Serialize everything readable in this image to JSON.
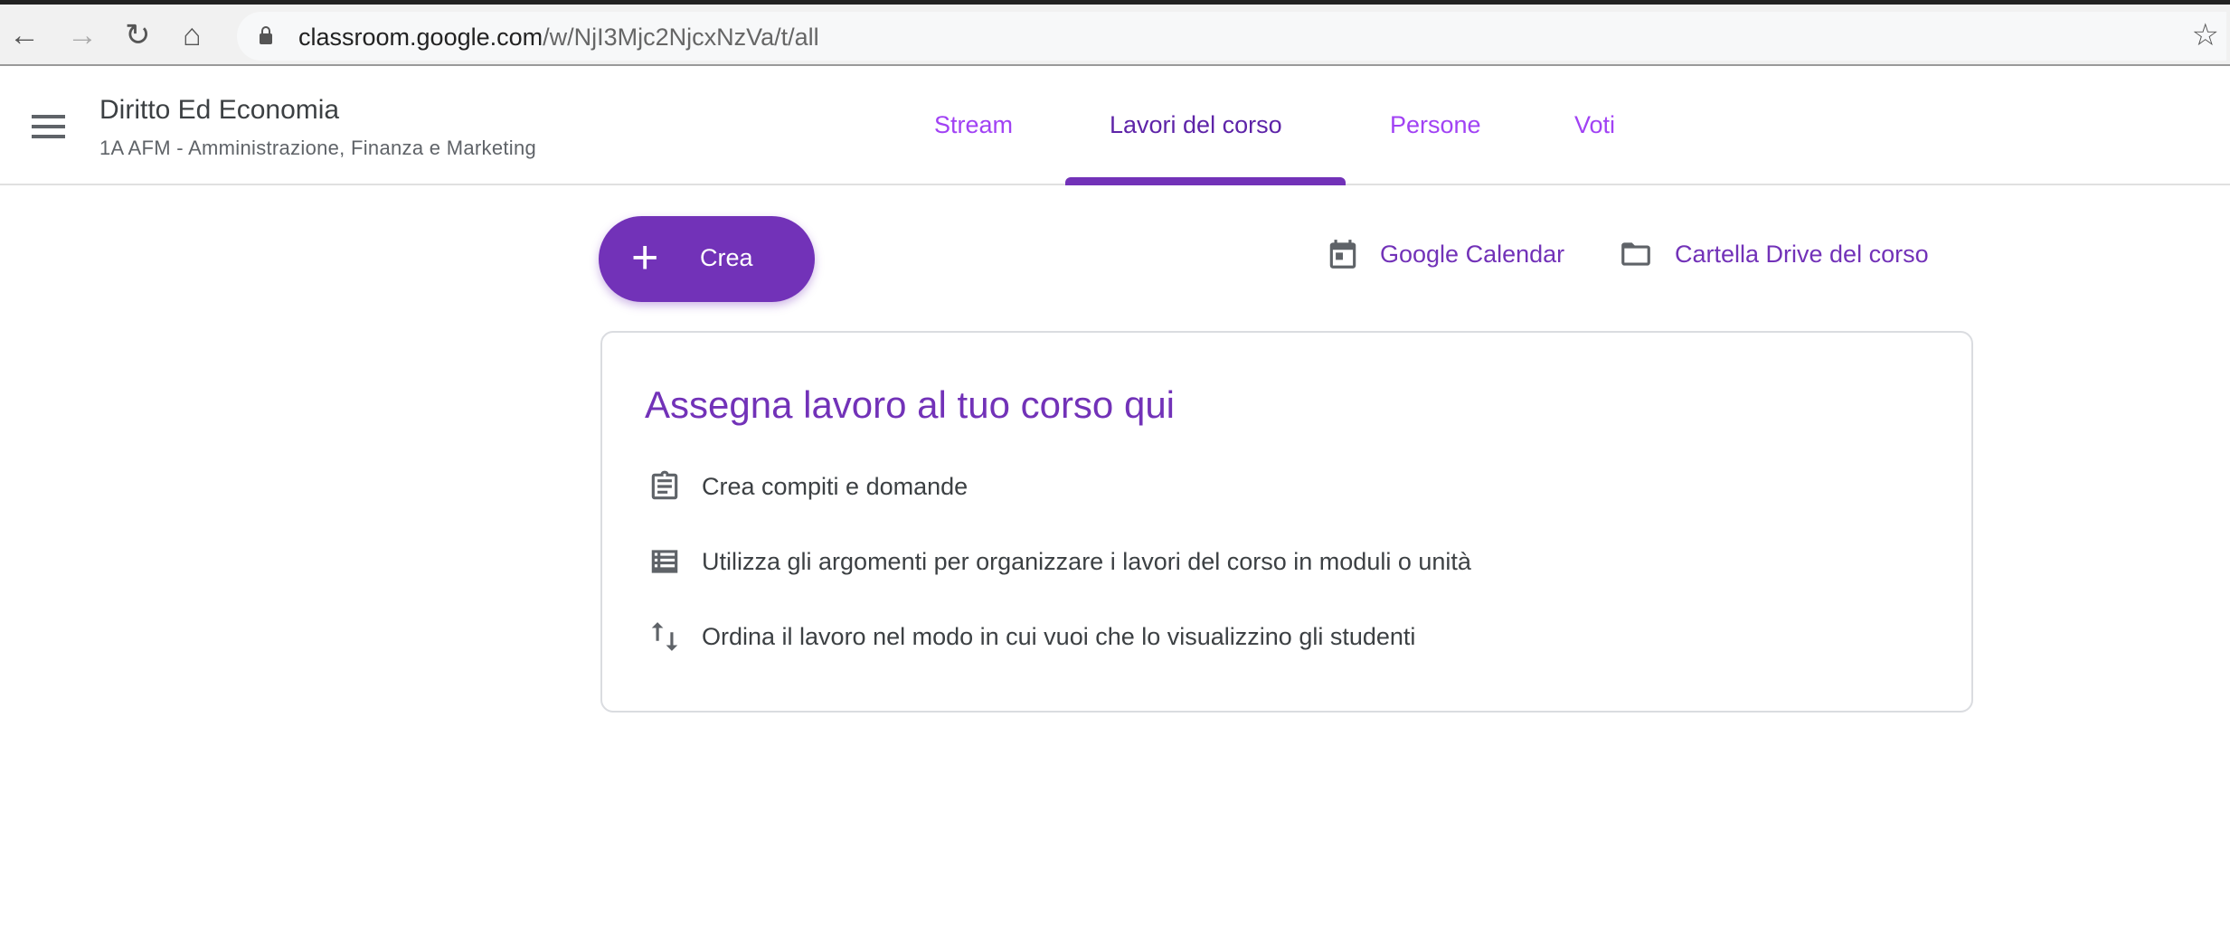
{
  "browser": {
    "url_host": "classroom.google.com",
    "url_path": "/w/NjI3Mjc2NjcxNzVa/t/all"
  },
  "header": {
    "title": "Diritto Ed Economia",
    "subtitle": "1A AFM - Amministrazione, Finanza e Marketing",
    "tabs": [
      {
        "label": "Stream"
      },
      {
        "label": "Lavori del corso",
        "active": true
      },
      {
        "label": "Persone"
      },
      {
        "label": "Voti"
      }
    ]
  },
  "actions": {
    "create_label": "Crea",
    "calendar_label": "Google Calendar",
    "drive_label": "Cartella Drive del corso"
  },
  "card": {
    "title": "Assegna lavoro al tuo corso qui",
    "items": [
      {
        "icon": "assignment-icon",
        "text": "Crea compiti e domande"
      },
      {
        "icon": "topic-list-icon",
        "text": "Utilizza gli argomenti per organizzare i lavori del corso in moduli o unità"
      },
      {
        "icon": "reorder-icon",
        "text": "Ordina il lavoro nel modo in cui vuoi che lo visualizzino gli studenti"
      }
    ]
  },
  "colors": {
    "accent": "#7232b8",
    "tab_inactive": "#a142f4",
    "tab_active": "#5e24a8"
  }
}
